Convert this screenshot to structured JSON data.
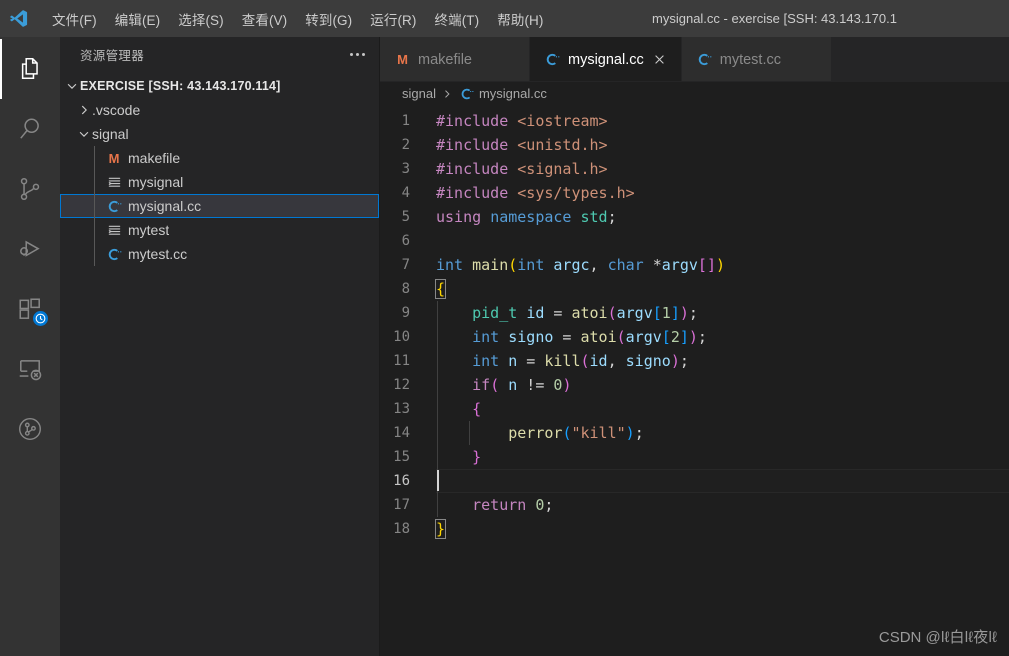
{
  "titlebar": {
    "logo_icon": "vscode-logo-icon",
    "window_title": "mysignal.cc - exercise [SSH: 43.143.170.1",
    "menu": [
      {
        "label": "文件(F)",
        "name": "menu-file"
      },
      {
        "label": "编辑(E)",
        "name": "menu-edit"
      },
      {
        "label": "选择(S)",
        "name": "menu-selection"
      },
      {
        "label": "查看(V)",
        "name": "menu-view"
      },
      {
        "label": "转到(G)",
        "name": "menu-go"
      },
      {
        "label": "运行(R)",
        "name": "menu-run"
      },
      {
        "label": "终端(T)",
        "name": "menu-terminal"
      },
      {
        "label": "帮助(H)",
        "name": "menu-help"
      }
    ]
  },
  "activitybar": {
    "items": [
      {
        "icon": "explorer-files-icon",
        "name": "activity-bar-explorer",
        "active": true,
        "badge": null
      },
      {
        "icon": "search-icon",
        "name": "activity-bar-search",
        "active": false,
        "badge": null
      },
      {
        "icon": "source-control-icon",
        "name": "activity-bar-source-control",
        "active": false,
        "badge": null
      },
      {
        "icon": "run-and-debug-icon",
        "name": "activity-bar-run-debug",
        "active": false,
        "badge": null
      },
      {
        "icon": "extensions-icon",
        "name": "activity-bar-extensions",
        "active": false,
        "badge": "clock-badge-icon"
      },
      {
        "icon": "remote-explorer-icon",
        "name": "activity-bar-remote-explorer",
        "active": false,
        "badge": null
      },
      {
        "icon": "timeline-circle-icon",
        "name": "activity-bar-timeline",
        "active": false,
        "badge": null
      }
    ]
  },
  "sidebar": {
    "title": "资源管理器",
    "more_actions_icon": "more-actions-icon",
    "tree": [
      {
        "label": "EXERCISE [SSH: 43.143.170.114]",
        "name": "tree-root-exercise",
        "depth": 0,
        "twisty": "chevron-down-icon",
        "icon": null,
        "icon_color": "",
        "selected": false,
        "root": true
      },
      {
        "label": ".vscode",
        "name": "tree-folder-vscode",
        "depth": 1,
        "twisty": "chevron-right-icon",
        "icon": null,
        "icon_color": "",
        "selected": false,
        "root": false
      },
      {
        "label": "signal",
        "name": "tree-folder-signal",
        "depth": 1,
        "twisty": "chevron-down-icon",
        "icon": null,
        "icon_color": "",
        "selected": false,
        "root": false
      },
      {
        "label": "makefile",
        "name": "tree-file-makefile",
        "depth": 2,
        "twisty": null,
        "icon": "makefile-icon",
        "icon_color": "#e8754a",
        "selected": false,
        "root": false
      },
      {
        "label": "mysignal",
        "name": "tree-file-mysignal",
        "depth": 2,
        "twisty": null,
        "icon": "binary-file-icon",
        "icon_color": "#c5c5c5",
        "selected": false,
        "root": false
      },
      {
        "label": "mysignal.cc",
        "name": "tree-file-mysignal-cc",
        "depth": 2,
        "twisty": null,
        "icon": "cpp-file-icon",
        "icon_color": "#3b9cd9",
        "selected": true,
        "root": false
      },
      {
        "label": "mytest",
        "name": "tree-file-mytest",
        "depth": 2,
        "twisty": null,
        "icon": "binary-file-icon",
        "icon_color": "#c5c5c5",
        "selected": false,
        "root": false
      },
      {
        "label": "mytest.cc",
        "name": "tree-file-mytest-cc",
        "depth": 2,
        "twisty": null,
        "icon": "cpp-file-icon",
        "icon_color": "#3b9cd9",
        "selected": false,
        "root": false
      }
    ]
  },
  "editor": {
    "tabs": [
      {
        "label": "makefile",
        "name": "tab-makefile",
        "icon": "makefile-icon",
        "icon_color": "#e8754a",
        "active": false,
        "closable": false
      },
      {
        "label": "mysignal.cc",
        "name": "tab-mysignal-cc",
        "icon": "cpp-file-icon",
        "icon_color": "#3b9cd9",
        "active": true,
        "closable": true
      },
      {
        "label": "mytest.cc",
        "name": "tab-mytest-cc",
        "icon": "cpp-file-icon",
        "icon_color": "#3b9cd9",
        "active": false,
        "closable": false
      }
    ],
    "close_icon": "close-icon",
    "breadcrumbs": {
      "folder": "signal",
      "separator_icon": "chevron-right-icon",
      "file_icon": "cpp-file-icon",
      "file": "mysignal.cc"
    },
    "active_line": 16,
    "cursor_line": 16,
    "language": "cpp",
    "lines": [
      {
        "n": 1,
        "tokens": [
          {
            "t": "#include ",
            "c": "t-pre"
          },
          {
            "t": "<iostream>",
            "c": "t-str"
          }
        ]
      },
      {
        "n": 2,
        "tokens": [
          {
            "t": "#include ",
            "c": "t-pre"
          },
          {
            "t": "<unistd.h>",
            "c": "t-str"
          }
        ]
      },
      {
        "n": 3,
        "tokens": [
          {
            "t": "#include ",
            "c": "t-pre"
          },
          {
            "t": "<signal.h>",
            "c": "t-str"
          }
        ]
      },
      {
        "n": 4,
        "tokens": [
          {
            "t": "#include ",
            "c": "t-pre"
          },
          {
            "t": "<sys/types.h>",
            "c": "t-str"
          }
        ]
      },
      {
        "n": 5,
        "tokens": [
          {
            "t": "using",
            "c": "t-ctl"
          },
          {
            "t": " ",
            "c": "t-op"
          },
          {
            "t": "namespace",
            "c": "t-kw"
          },
          {
            "t": " ",
            "c": "t-op"
          },
          {
            "t": "std",
            "c": "t-type"
          },
          {
            "t": ";",
            "c": "t-op"
          }
        ]
      },
      {
        "n": 6,
        "tokens": []
      },
      {
        "n": 7,
        "tokens": [
          {
            "t": "int",
            "c": "t-kw"
          },
          {
            "t": " ",
            "c": "t-op"
          },
          {
            "t": "main",
            "c": "t-fn"
          },
          {
            "t": "(",
            "c": "b-yel"
          },
          {
            "t": "int",
            "c": "t-kw"
          },
          {
            "t": " ",
            "c": "t-op"
          },
          {
            "t": "argc",
            "c": "t-var"
          },
          {
            "t": ", ",
            "c": "t-op"
          },
          {
            "t": "char",
            "c": "t-kw"
          },
          {
            "t": " *",
            "c": "t-op"
          },
          {
            "t": "argv",
            "c": "t-var"
          },
          {
            "t": "[",
            "c": "b-mag"
          },
          {
            "t": "]",
            "c": "b-mag"
          },
          {
            "t": ")",
            "c": "b-yel"
          }
        ]
      },
      {
        "n": 8,
        "tokens": [
          {
            "t": "{",
            "c": "b-yel"
          }
        ]
      },
      {
        "n": 9,
        "tokens": [
          {
            "t": "    ",
            "c": "t-op"
          },
          {
            "t": "pid_t",
            "c": "t-type"
          },
          {
            "t": " ",
            "c": "t-op"
          },
          {
            "t": "id",
            "c": "t-var"
          },
          {
            "t": " = ",
            "c": "t-op"
          },
          {
            "t": "atoi",
            "c": "t-fn"
          },
          {
            "t": "(",
            "c": "b-mag"
          },
          {
            "t": "argv",
            "c": "t-var"
          },
          {
            "t": "[",
            "c": "b-blu"
          },
          {
            "t": "1",
            "c": "t-num"
          },
          {
            "t": "]",
            "c": "b-blu"
          },
          {
            "t": ")",
            "c": "b-mag"
          },
          {
            "t": ";",
            "c": "t-op"
          }
        ]
      },
      {
        "n": 10,
        "tokens": [
          {
            "t": "    ",
            "c": "t-op"
          },
          {
            "t": "int",
            "c": "t-kw"
          },
          {
            "t": " ",
            "c": "t-op"
          },
          {
            "t": "signo",
            "c": "t-var"
          },
          {
            "t": " = ",
            "c": "t-op"
          },
          {
            "t": "atoi",
            "c": "t-fn"
          },
          {
            "t": "(",
            "c": "b-mag"
          },
          {
            "t": "argv",
            "c": "t-var"
          },
          {
            "t": "[",
            "c": "b-blu"
          },
          {
            "t": "2",
            "c": "t-num"
          },
          {
            "t": "]",
            "c": "b-blu"
          },
          {
            "t": ")",
            "c": "b-mag"
          },
          {
            "t": ";",
            "c": "t-op"
          }
        ]
      },
      {
        "n": 11,
        "tokens": [
          {
            "t": "    ",
            "c": "t-op"
          },
          {
            "t": "int",
            "c": "t-kw"
          },
          {
            "t": " ",
            "c": "t-op"
          },
          {
            "t": "n",
            "c": "t-var"
          },
          {
            "t": " = ",
            "c": "t-op"
          },
          {
            "t": "kill",
            "c": "t-fn"
          },
          {
            "t": "(",
            "c": "b-mag"
          },
          {
            "t": "id",
            "c": "t-var"
          },
          {
            "t": ", ",
            "c": "t-op"
          },
          {
            "t": "signo",
            "c": "t-var"
          },
          {
            "t": ")",
            "c": "b-mag"
          },
          {
            "t": ";",
            "c": "t-op"
          }
        ]
      },
      {
        "n": 12,
        "tokens": [
          {
            "t": "    ",
            "c": "t-op"
          },
          {
            "t": "if",
            "c": "t-ctl"
          },
          {
            "t": "(",
            "c": "b-mag"
          },
          {
            "t": " ",
            "c": "t-op"
          },
          {
            "t": "n",
            "c": "t-var"
          },
          {
            "t": " != ",
            "c": "t-op"
          },
          {
            "t": "0",
            "c": "t-num"
          },
          {
            "t": ")",
            "c": "b-mag"
          }
        ]
      },
      {
        "n": 13,
        "tokens": [
          {
            "t": "    ",
            "c": "t-op"
          },
          {
            "t": "{",
            "c": "b-mag"
          }
        ]
      },
      {
        "n": 14,
        "tokens": [
          {
            "t": "        ",
            "c": "t-op"
          },
          {
            "t": "perror",
            "c": "t-fn"
          },
          {
            "t": "(",
            "c": "b-blu"
          },
          {
            "t": "\"kill\"",
            "c": "t-str"
          },
          {
            "t": ")",
            "c": "b-blu"
          },
          {
            "t": ";",
            "c": "t-op"
          }
        ]
      },
      {
        "n": 15,
        "tokens": [
          {
            "t": "    ",
            "c": "t-op"
          },
          {
            "t": "}",
            "c": "b-mag"
          }
        ]
      },
      {
        "n": 16,
        "tokens": []
      },
      {
        "n": 17,
        "tokens": [
          {
            "t": "    ",
            "c": "t-op"
          },
          {
            "t": "return",
            "c": "t-ctl"
          },
          {
            "t": " ",
            "c": "t-op"
          },
          {
            "t": "0",
            "c": "t-num"
          },
          {
            "t": ";",
            "c": "t-op"
          }
        ]
      },
      {
        "n": 18,
        "tokens": [
          {
            "t": "}",
            "c": "b-yel"
          }
        ]
      }
    ]
  },
  "watermark": "CSDN @ǀℓ白ǀℓ夜ǀℓ"
}
